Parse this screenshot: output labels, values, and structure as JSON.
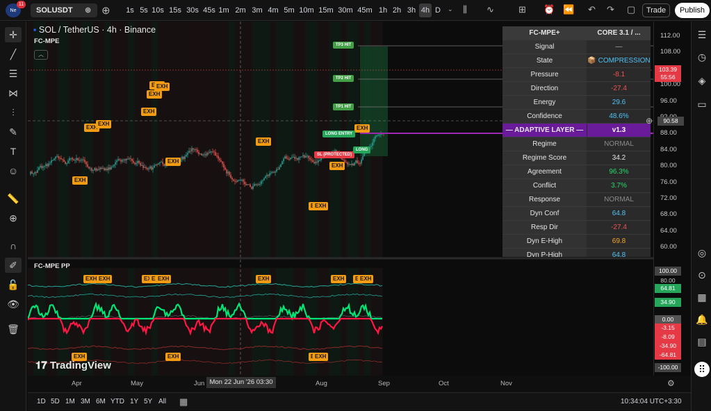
{
  "topbar": {
    "logo_text": "Ne",
    "notification_count": "11",
    "symbol": "SOLUSDT",
    "timeframes": [
      "1s",
      "5s",
      "10s",
      "15s",
      "30s",
      "45s",
      "1m",
      "2m",
      "3m",
      "4m",
      "5m",
      "10m",
      "15m",
      "30m",
      "45m",
      "1h",
      "2h",
      "3h",
      "4h",
      "D"
    ],
    "active_timeframe": "4h",
    "trade_label": "Trade",
    "publish_label": "Publish"
  },
  "chart": {
    "title": "SOL / TetherUS · 4h · Binance",
    "indicator_title": "FC-MPE",
    "collapse_glyph": "︿",
    "pp_title": "FC-MPE PP",
    "tv_logo_text": "TradingView",
    "signals": {
      "tp3": "TP3 HIT",
      "tp2": "TP2 HIT",
      "tp1": "TP1 HIT",
      "long_entry": "LONG ENTRY",
      "sl": "SL (PROTECTED)",
      "long": "LONG"
    },
    "exh_label": "EXH"
  },
  "price_axis": {
    "labels": [
      "112.00",
      "108.00",
      "104.00",
      "100.00",
      "96.00",
      "92.00",
      "88.00",
      "84.00",
      "80.00",
      "76.00",
      "72.00",
      "68.00",
      "64.00",
      "60.00"
    ],
    "current_price": "103.39",
    "countdown": "55:56",
    "crosshair_price": "90.58",
    "pp_labels": [
      "100.00",
      "80.00",
      "64.81",
      "34.90",
      "0.00",
      "-3.15",
      "-8.09",
      "-34.90",
      "-64.81",
      "-100.00"
    ]
  },
  "panel": {
    "header_left": "FC-MPE+",
    "header_right": "CORE 3.1 / ...",
    "rows": [
      {
        "label": "Signal",
        "value": "—",
        "color": "#b0b0b0"
      },
      {
        "label": "State",
        "value": "📦 COMPRESSION",
        "color": "#4fc3f7"
      },
      {
        "label": "Pressure",
        "value": "-8.1",
        "color": "#ef5350"
      },
      {
        "label": "Direction",
        "value": "-27.4",
        "color": "#ef5350"
      },
      {
        "label": "Energy",
        "value": "29.6",
        "color": "#4fc3f7"
      },
      {
        "label": "Confidence",
        "value": "48.6%",
        "color": "#4fc3f7"
      },
      {
        "label": "— ADAPTIVE LAYER —",
        "value": "v1.3",
        "color": "#ffffff",
        "header": true
      },
      {
        "label": "Regime",
        "value": "NORMAL",
        "color": "#8a8a8a"
      },
      {
        "label": "Regime Score",
        "value": "34.2",
        "color": "#e6e6e6"
      },
      {
        "label": "Agreement",
        "value": "96.3%",
        "color": "#26d96a"
      },
      {
        "label": "Conflict",
        "value": "3.7%",
        "color": "#26d96a"
      },
      {
        "label": "Response",
        "value": "NORMAL",
        "color": "#8a8a8a"
      },
      {
        "label": "Dyn Conf",
        "value": "64.8",
        "color": "#4fc3f7"
      },
      {
        "label": "Resp Dir",
        "value": "-27.4",
        "color": "#ef5350"
      },
      {
        "label": "Dyn E-High",
        "value": "69.8",
        "color": "#f5a623"
      },
      {
        "label": "Dyn P-High",
        "value": "64.8",
        "color": "#4fc3f7"
      }
    ]
  },
  "time_axis": {
    "months": [
      "Apr",
      "May",
      "Jun",
      "Aug",
      "Sep",
      "Oct",
      "Nov"
    ],
    "crosshair_time": "Mon 22 Jun '26   03:30"
  },
  "bottombar": {
    "ranges": [
      "1D",
      "5D",
      "1M",
      "3M",
      "6M",
      "YTD",
      "1Y",
      "5Y",
      "All"
    ],
    "clock": "10:34:04 UTC+3:30"
  },
  "colors": {
    "up": "#26a69a",
    "down": "#ef5350",
    "exh": "#f39c12",
    "adaptive": "#7b1fa2"
  }
}
